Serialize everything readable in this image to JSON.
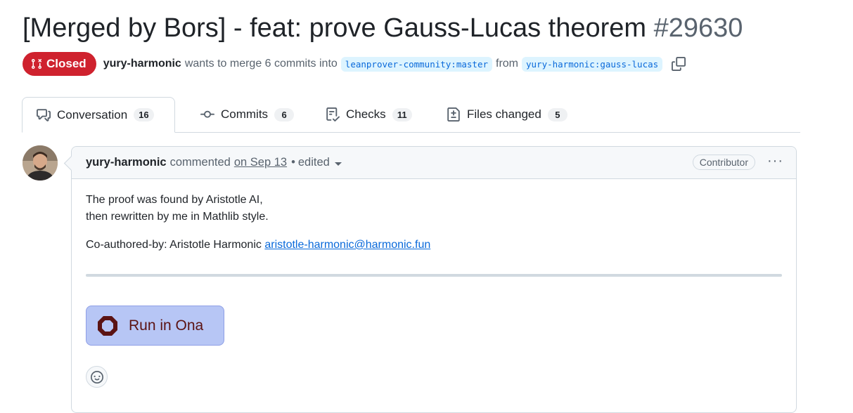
{
  "pr": {
    "title": "[Merged by Bors] - feat: prove Gauss-Lucas theorem",
    "number": "#29630",
    "state": "Closed",
    "author": "yury-harmonic",
    "merge_text": "wants to merge 6 commits into",
    "base_branch": "leanprover-community:master",
    "from_text": "from",
    "head_branch": "yury-harmonic:gauss-lucas"
  },
  "tabs": [
    {
      "label": "Conversation",
      "count": "16"
    },
    {
      "label": "Commits",
      "count": "6"
    },
    {
      "label": "Checks",
      "count": "11"
    },
    {
      "label": "Files changed",
      "count": "5"
    }
  ],
  "comment": {
    "author": "yury-harmonic",
    "action": "commented",
    "date": "on Sep 13",
    "separator": "•",
    "edited": "edited",
    "role": "Contributor",
    "menu": "···",
    "line1": "The proof was found by Aristotle AI,",
    "line2": "then rewritten by me in Mathlib style.",
    "coauthor_prefix": "Co-authored-by: Aristotle Harmonic",
    "coauthor_email": "aristotle-harmonic@harmonic.fun",
    "button_label": "Run in Ona"
  },
  "colors": {
    "closed": "#cf222e",
    "link": "#0969da",
    "ona_bg": "#b7c6f5",
    "ona_text": "#5b1313"
  },
  "icons": [
    "pr-closed-icon",
    "copy-icon",
    "conversation-icon",
    "commits-icon",
    "checks-icon",
    "files-changed-icon",
    "ona-logo-icon",
    "smiley-icon",
    "caret-down-icon"
  ]
}
